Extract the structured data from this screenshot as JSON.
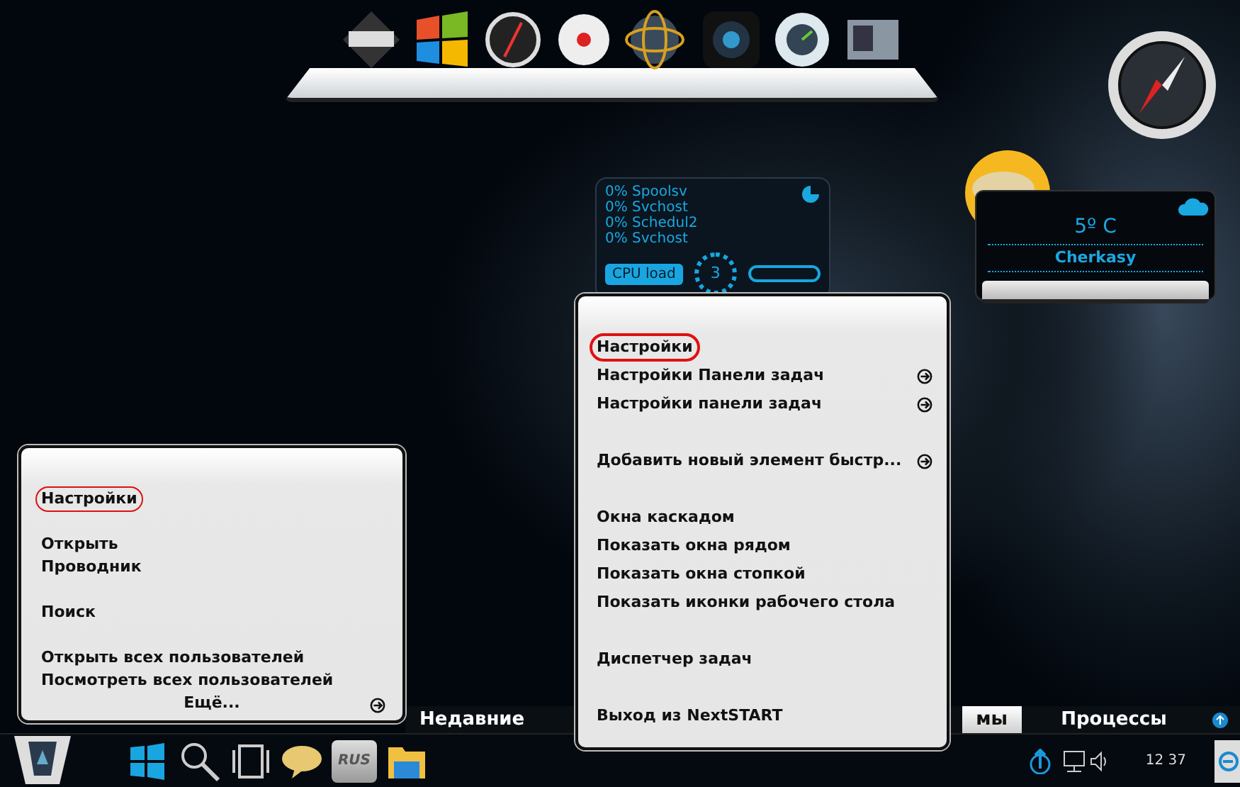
{
  "cpu_gadget": {
    "processes": [
      "0% Spoolsv",
      "0% Svchost",
      "0% Schedul2",
      "0% Svchost"
    ],
    "label": "CPU load",
    "value": "3"
  },
  "weather": {
    "temperature": "5º C",
    "city": "Cherkasy"
  },
  "left_menu": {
    "groups": [
      [
        {
          "label": "Настройки",
          "circled": true
        }
      ],
      [
        {
          "label": "Открыть",
          "circled": false
        },
        {
          "label": "Проводник",
          "circled": false
        }
      ],
      [
        {
          "label": "Поиск",
          "circled": false
        }
      ],
      [
        {
          "label": "Открыть всех пользователей",
          "circled": false
        },
        {
          "label": "Посмотреть всех пользователей",
          "circled": false
        }
      ]
    ],
    "more": "Ещё..."
  },
  "right_menu": {
    "groups": [
      [
        {
          "label": "Настройки",
          "circled": true,
          "submenu": false
        },
        {
          "label": "Настройки Панели задач",
          "circled": false,
          "submenu": true
        },
        {
          "label": "Настройки панели задач",
          "circled": false,
          "submenu": true
        }
      ],
      [
        {
          "label": "Добавить новый элемент быстр...",
          "circled": false,
          "submenu": true
        }
      ],
      [
        {
          "label": "Окна каскадом",
          "circled": false,
          "submenu": false
        },
        {
          "label": "Показать окна рядом",
          "circled": false,
          "submenu": false
        },
        {
          "label": "Показать окна стопкой",
          "circled": false,
          "submenu": false
        },
        {
          "label": "Показать иконки рабочего стола",
          "circled": false,
          "submenu": false
        }
      ],
      [
        {
          "label": "Диспетчер задач",
          "circled": false,
          "submenu": false
        }
      ],
      [
        {
          "label": "Выход из NextSTART",
          "circled": false,
          "submenu": false
        }
      ]
    ]
  },
  "taskbar": {
    "tabs": [
      {
        "label": "Недавние",
        "selected": false
      },
      {
        "label": "мы",
        "selected": true
      },
      {
        "label": "Процессы",
        "selected": false
      }
    ],
    "language": "RUS",
    "clock": "12 37"
  }
}
